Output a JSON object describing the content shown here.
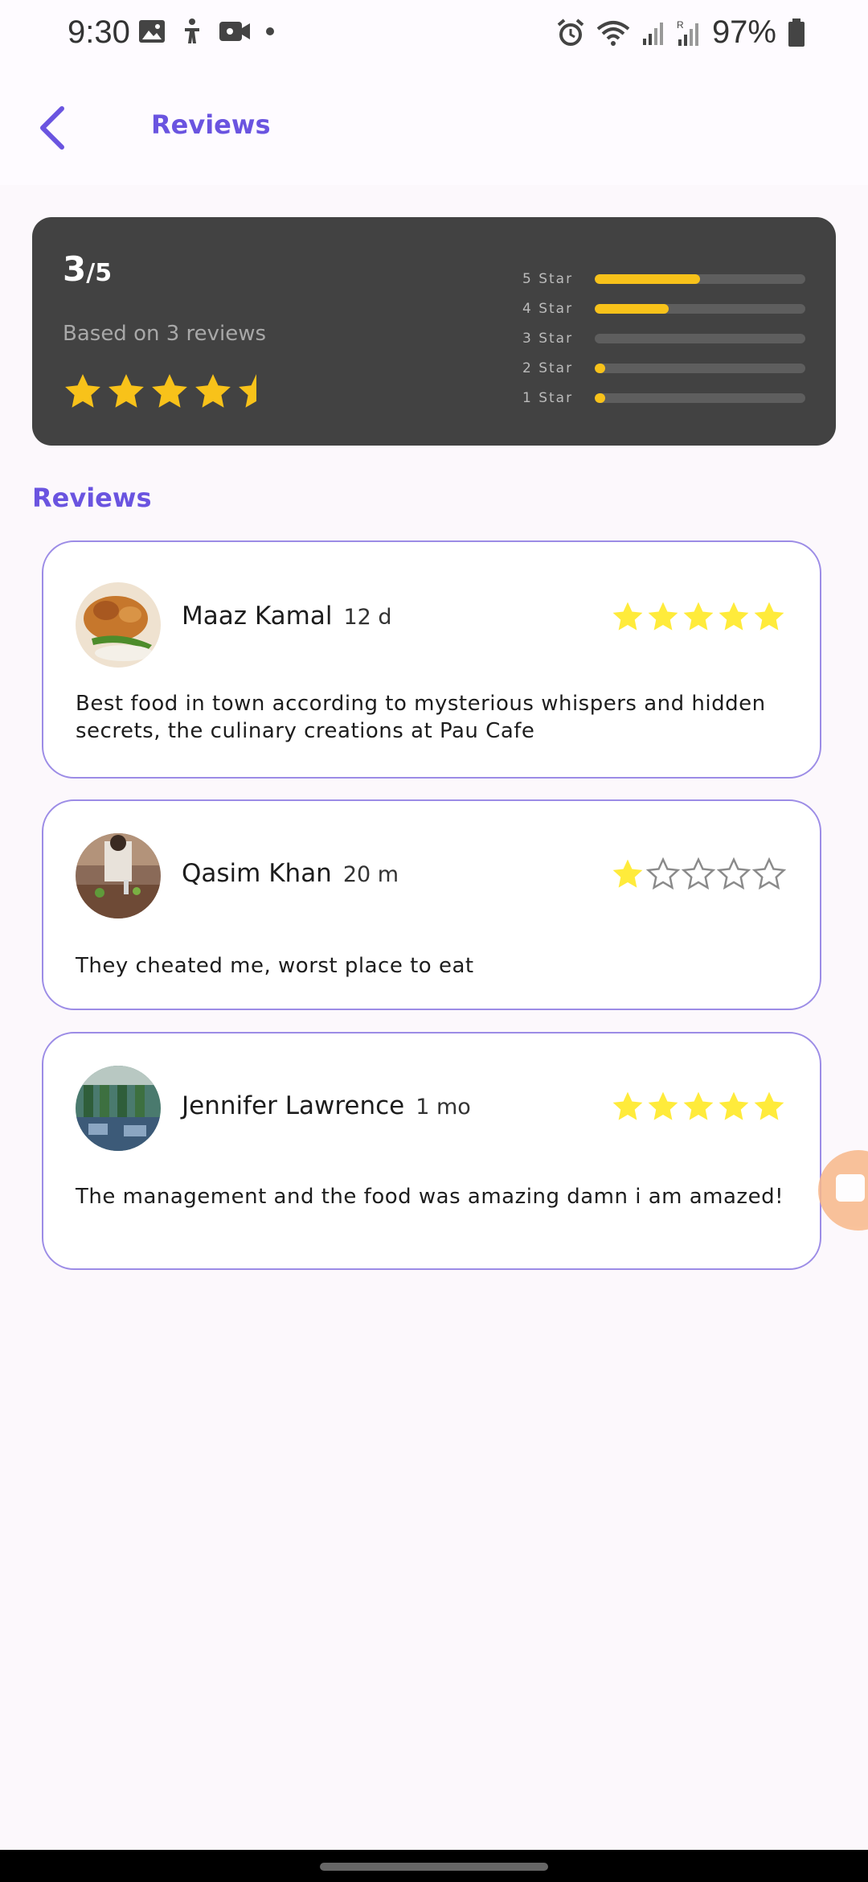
{
  "status": {
    "time": "9:30",
    "battery": "97%"
  },
  "header": {
    "title": "Reviews"
  },
  "summary": {
    "score_main": "3",
    "score_sub": "/5",
    "based_on": "Based on 3 reviews",
    "stars_rating": 4.5,
    "bars": [
      {
        "label": "5 Star",
        "fraction": 0.5
      },
      {
        "label": "4 Star",
        "fraction": 0.35
      },
      {
        "label": "3 Star",
        "fraction": 0.0
      },
      {
        "label": "2 Star",
        "fraction": 0.05
      },
      {
        "label": "1 Star",
        "fraction": 0.05
      }
    ]
  },
  "section_title": "Reviews",
  "reviews": [
    {
      "name": "Maaz Kamal",
      "time": "12 d",
      "rating": 5,
      "text": "Best food in town according to mysterious whispers and hidden secrets, the culinary creations at Pau Cafe"
    },
    {
      "name": "Qasim Khan",
      "time": "20 m",
      "rating": 1,
      "text": "They cheated me, worst place to eat"
    },
    {
      "name": "Jennifer Lawrence",
      "time": "1 mo",
      "rating": 5,
      "text": "The management and the food was amazing damn i am amazed!"
    }
  ],
  "colors": {
    "accent": "#6a54e0",
    "star_summary": "#f8c21a",
    "star_review": "#ffeb3b",
    "card_dark": "#424242"
  },
  "icons": {
    "back": "chevron-left-icon",
    "star": "star-icon",
    "star_outline": "star-outline-icon"
  }
}
